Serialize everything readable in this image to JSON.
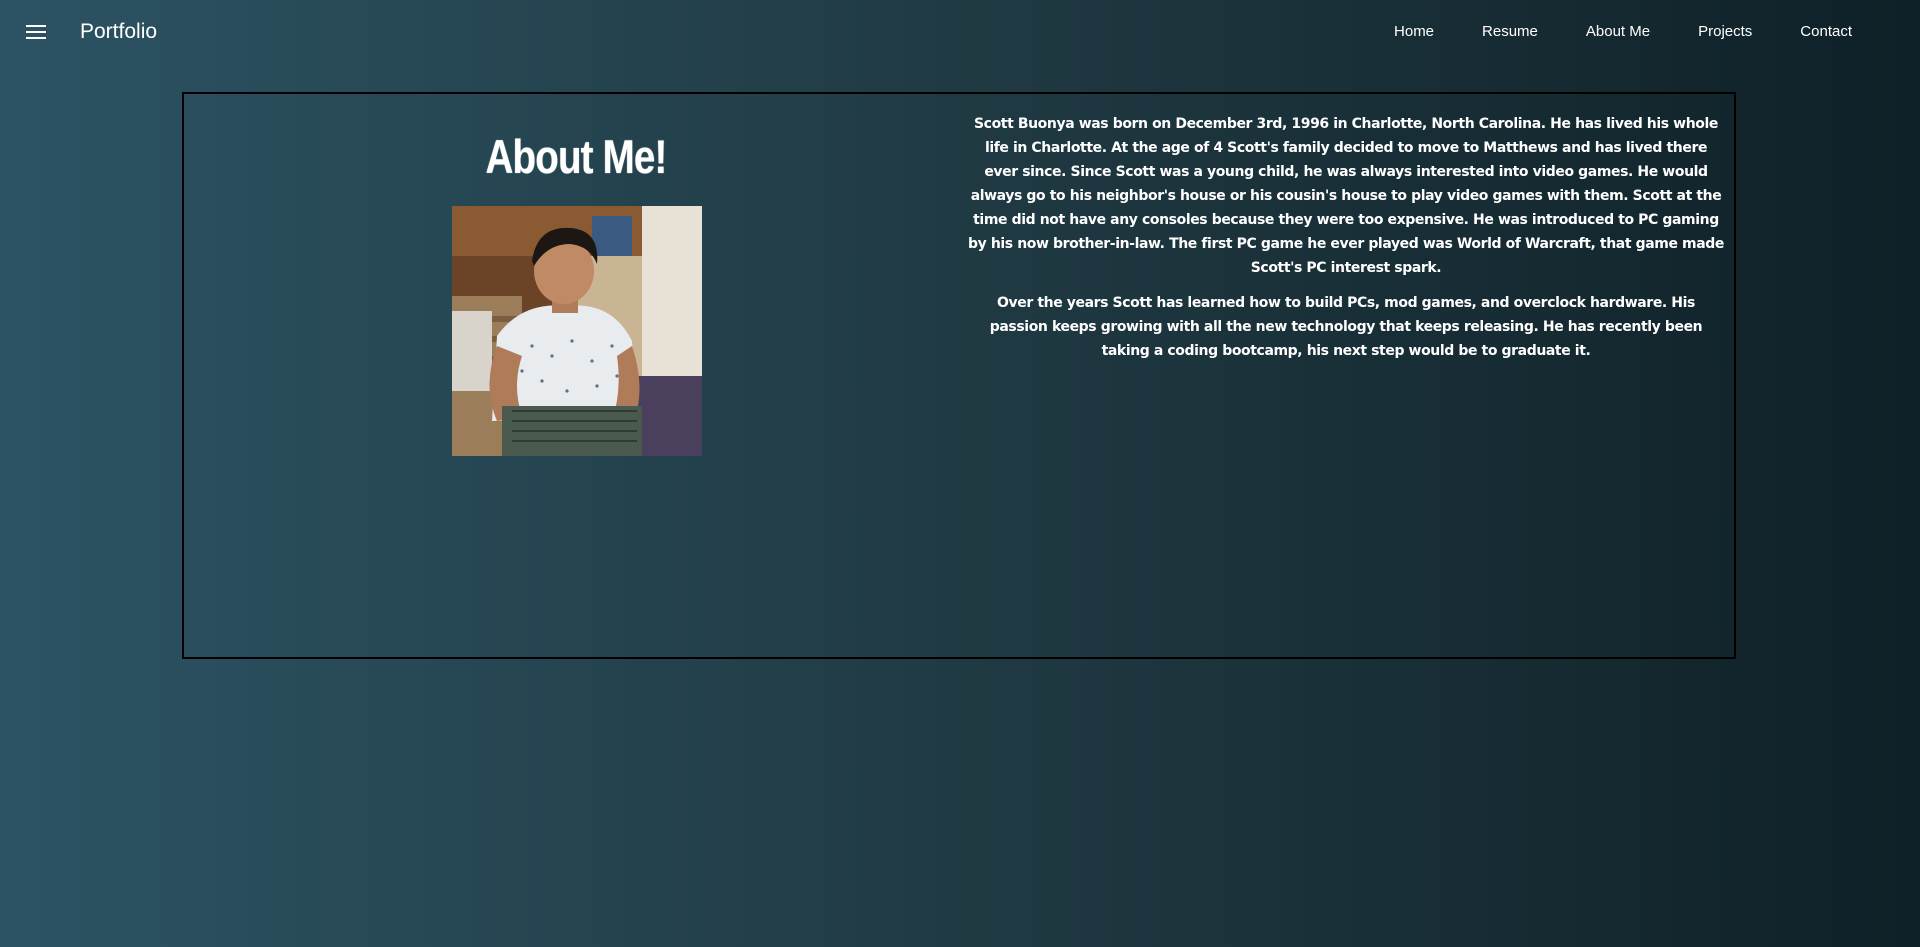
{
  "navbar": {
    "brand": "Portfolio",
    "links": [
      "Home",
      "Resume",
      "About Me",
      "Projects",
      "Contact"
    ]
  },
  "about": {
    "heading": "About Me!",
    "paragraphs": [
      "Scott Buonya was born on December 3rd, 1996 in Charlotte, North Carolina. He has lived his whole life in Charlotte. At the age of 4 Scott's family decided to move to Matthews and has lived there ever since. Since Scott was a young child, he was always interested into video games. He would always go to his neighbor's house or his cousin's house to play video games with them. Scott at the time did not have any consoles because they were too expensive. He was introduced to PC gaming by his now brother-in-law. The first PC game he ever played was World of Warcraft, that game made Scott's PC interest spark.",
      "Over the years Scott has learned how to build PCs, mod games, and overclock hardware. His passion keeps growing with all the new technology that keeps releasing. He has recently been taking a coding bootcamp, his next step would be to graduate it."
    ]
  },
  "colors": {
    "gradient_start": "#2c5364",
    "gradient_mid": "#203a43",
    "gradient_end": "#0f2027",
    "text": "#ffffff",
    "card_border": "#000000"
  },
  "icons": {
    "menu": "hamburger-menu-icon"
  }
}
